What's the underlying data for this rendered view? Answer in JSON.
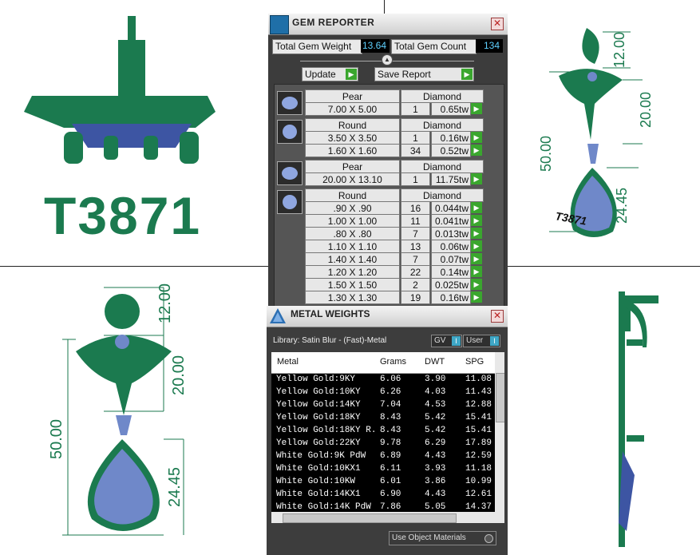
{
  "model_label": "T3871",
  "dimensions": {
    "front": [
      "12.00",
      "20.00",
      "50.00",
      "24.45"
    ],
    "right": [
      "12.00",
      "20.00",
      "50.00",
      "24.45"
    ]
  },
  "side_engraving": "T3871",
  "gem_reporter": {
    "title": "GEM REPORTER",
    "total_weight_label": "Total Gem Weight",
    "total_weight_value": "13.64",
    "total_count_label": "Total Gem Count",
    "total_count_value": "134",
    "update_label": "Update",
    "save_report_label": "Save Report",
    "groups": [
      {
        "shape": "Pear",
        "material": "Diamond",
        "rows": [
          {
            "size": "7.00 X 5.00",
            "count": "1",
            "weight": "0.65tw"
          }
        ]
      },
      {
        "shape": "Round",
        "material": "Diamond",
        "rows": [
          {
            "size": "3.50 X 3.50",
            "count": "1",
            "weight": "0.16tw"
          },
          {
            "size": "1.60 X 1.60",
            "count": "34",
            "weight": "0.52tw"
          }
        ]
      },
      {
        "shape": "Pear",
        "material": "Diamond",
        "rows": [
          {
            "size": "20.00 X 13.10",
            "count": "1",
            "weight": "11.75tw"
          }
        ]
      },
      {
        "shape": "Round",
        "material": "Diamond",
        "rows": [
          {
            "size": ".90 X .90",
            "count": "16",
            "weight": "0.044tw"
          },
          {
            "size": "1.00 X 1.00",
            "count": "11",
            "weight": "0.041tw"
          },
          {
            "size": ".80 X .80",
            "count": "7",
            "weight": "0.013tw"
          },
          {
            "size": "1.10 X 1.10",
            "count": "13",
            "weight": "0.06tw"
          },
          {
            "size": "1.40 X 1.40",
            "count": "7",
            "weight": "0.07tw"
          },
          {
            "size": "1.20 X 1.20",
            "count": "22",
            "weight": "0.14tw"
          },
          {
            "size": "1.50 X 1.50",
            "count": "2",
            "weight": "0.025tw"
          },
          {
            "size": "1.30 X 1.30",
            "count": "19",
            "weight": "0.16tw"
          }
        ]
      }
    ]
  },
  "metal_weights": {
    "title": "METAL WEIGHTS",
    "library": "Library: Satin Blur - (Fast)-Metal",
    "gv_label": "GV",
    "user_label": "User",
    "toggle_icon": "I",
    "columns": [
      "Metal",
      "Grams",
      "DWT",
      "SPG"
    ],
    "rows": [
      [
        "Yellow Gold:9KY",
        "6.06",
        "3.90",
        "11.08"
      ],
      [
        "Yellow Gold:10KY",
        "6.26",
        "4.03",
        "11.43"
      ],
      [
        "Yellow Gold:14KY",
        "7.04",
        "4.53",
        "12.88"
      ],
      [
        "Yellow Gold:18KY",
        "8.43",
        "5.42",
        "15.41"
      ],
      [
        "Yellow Gold:18KY R...",
        "8.43",
        "5.42",
        "15.41"
      ],
      [
        "Yellow Gold:22KY",
        "9.78",
        "6.29",
        "17.89"
      ],
      [
        "White Gold:9K PdW",
        "6.89",
        "4.43",
        "12.59"
      ],
      [
        "White Gold:10KX1",
        "6.11",
        "3.93",
        "11.18"
      ],
      [
        "White Gold:10KW",
        "6.01",
        "3.86",
        "10.99"
      ],
      [
        "White Gold:14KX1",
        "6.90",
        "4.43",
        "12.61"
      ],
      [
        "White Gold:14K PdW",
        "7.86",
        "5.05",
        "14.37"
      ]
    ],
    "use_object_materials": "Use Object Materials"
  },
  "colors": {
    "metal": "#1b7a4f",
    "gem": "#6f88c9",
    "accent_green": "#3aa62e"
  }
}
